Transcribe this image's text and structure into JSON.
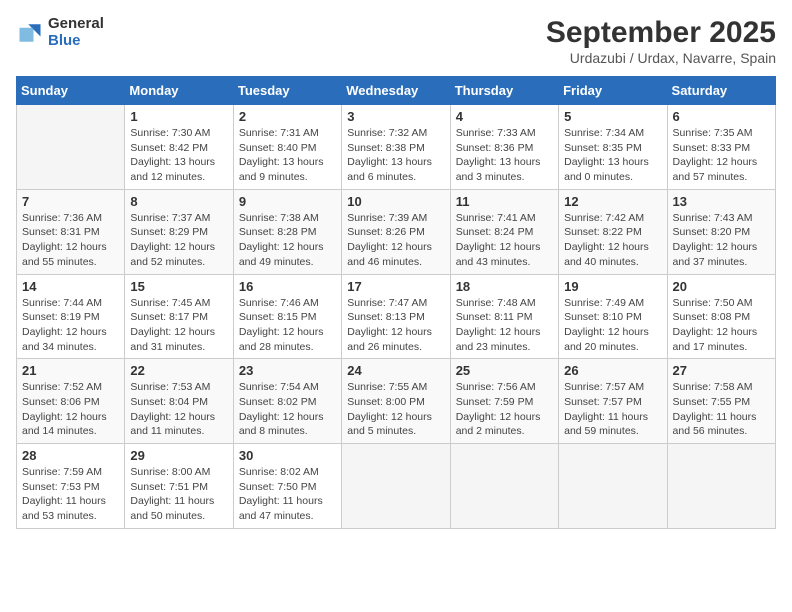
{
  "logo": {
    "general": "General",
    "blue": "Blue"
  },
  "title": "September 2025",
  "location": "Urdazubi / Urdax, Navarre, Spain",
  "days_header": [
    "Sunday",
    "Monday",
    "Tuesday",
    "Wednesday",
    "Thursday",
    "Friday",
    "Saturday"
  ],
  "weeks": [
    [
      {
        "day": "",
        "info": ""
      },
      {
        "day": "1",
        "info": "Sunrise: 7:30 AM\nSunset: 8:42 PM\nDaylight: 13 hours\nand 12 minutes."
      },
      {
        "day": "2",
        "info": "Sunrise: 7:31 AM\nSunset: 8:40 PM\nDaylight: 13 hours\nand 9 minutes."
      },
      {
        "day": "3",
        "info": "Sunrise: 7:32 AM\nSunset: 8:38 PM\nDaylight: 13 hours\nand 6 minutes."
      },
      {
        "day": "4",
        "info": "Sunrise: 7:33 AM\nSunset: 8:36 PM\nDaylight: 13 hours\nand 3 minutes."
      },
      {
        "day": "5",
        "info": "Sunrise: 7:34 AM\nSunset: 8:35 PM\nDaylight: 13 hours\nand 0 minutes."
      },
      {
        "day": "6",
        "info": "Sunrise: 7:35 AM\nSunset: 8:33 PM\nDaylight: 12 hours\nand 57 minutes."
      }
    ],
    [
      {
        "day": "7",
        "info": "Sunrise: 7:36 AM\nSunset: 8:31 PM\nDaylight: 12 hours\nand 55 minutes."
      },
      {
        "day": "8",
        "info": "Sunrise: 7:37 AM\nSunset: 8:29 PM\nDaylight: 12 hours\nand 52 minutes."
      },
      {
        "day": "9",
        "info": "Sunrise: 7:38 AM\nSunset: 8:28 PM\nDaylight: 12 hours\nand 49 minutes."
      },
      {
        "day": "10",
        "info": "Sunrise: 7:39 AM\nSunset: 8:26 PM\nDaylight: 12 hours\nand 46 minutes."
      },
      {
        "day": "11",
        "info": "Sunrise: 7:41 AM\nSunset: 8:24 PM\nDaylight: 12 hours\nand 43 minutes."
      },
      {
        "day": "12",
        "info": "Sunrise: 7:42 AM\nSunset: 8:22 PM\nDaylight: 12 hours\nand 40 minutes."
      },
      {
        "day": "13",
        "info": "Sunrise: 7:43 AM\nSunset: 8:20 PM\nDaylight: 12 hours\nand 37 minutes."
      }
    ],
    [
      {
        "day": "14",
        "info": "Sunrise: 7:44 AM\nSunset: 8:19 PM\nDaylight: 12 hours\nand 34 minutes."
      },
      {
        "day": "15",
        "info": "Sunrise: 7:45 AM\nSunset: 8:17 PM\nDaylight: 12 hours\nand 31 minutes."
      },
      {
        "day": "16",
        "info": "Sunrise: 7:46 AM\nSunset: 8:15 PM\nDaylight: 12 hours\nand 28 minutes."
      },
      {
        "day": "17",
        "info": "Sunrise: 7:47 AM\nSunset: 8:13 PM\nDaylight: 12 hours\nand 26 minutes."
      },
      {
        "day": "18",
        "info": "Sunrise: 7:48 AM\nSunset: 8:11 PM\nDaylight: 12 hours\nand 23 minutes."
      },
      {
        "day": "19",
        "info": "Sunrise: 7:49 AM\nSunset: 8:10 PM\nDaylight: 12 hours\nand 20 minutes."
      },
      {
        "day": "20",
        "info": "Sunrise: 7:50 AM\nSunset: 8:08 PM\nDaylight: 12 hours\nand 17 minutes."
      }
    ],
    [
      {
        "day": "21",
        "info": "Sunrise: 7:52 AM\nSunset: 8:06 PM\nDaylight: 12 hours\nand 14 minutes."
      },
      {
        "day": "22",
        "info": "Sunrise: 7:53 AM\nSunset: 8:04 PM\nDaylight: 12 hours\nand 11 minutes."
      },
      {
        "day": "23",
        "info": "Sunrise: 7:54 AM\nSunset: 8:02 PM\nDaylight: 12 hours\nand 8 minutes."
      },
      {
        "day": "24",
        "info": "Sunrise: 7:55 AM\nSunset: 8:00 PM\nDaylight: 12 hours\nand 5 minutes."
      },
      {
        "day": "25",
        "info": "Sunrise: 7:56 AM\nSunset: 7:59 PM\nDaylight: 12 hours\nand 2 minutes."
      },
      {
        "day": "26",
        "info": "Sunrise: 7:57 AM\nSunset: 7:57 PM\nDaylight: 11 hours\nand 59 minutes."
      },
      {
        "day": "27",
        "info": "Sunrise: 7:58 AM\nSunset: 7:55 PM\nDaylight: 11 hours\nand 56 minutes."
      }
    ],
    [
      {
        "day": "28",
        "info": "Sunrise: 7:59 AM\nSunset: 7:53 PM\nDaylight: 11 hours\nand 53 minutes."
      },
      {
        "day": "29",
        "info": "Sunrise: 8:00 AM\nSunset: 7:51 PM\nDaylight: 11 hours\nand 50 minutes."
      },
      {
        "day": "30",
        "info": "Sunrise: 8:02 AM\nSunset: 7:50 PM\nDaylight: 11 hours\nand 47 minutes."
      },
      {
        "day": "",
        "info": ""
      },
      {
        "day": "",
        "info": ""
      },
      {
        "day": "",
        "info": ""
      },
      {
        "day": "",
        "info": ""
      }
    ]
  ]
}
